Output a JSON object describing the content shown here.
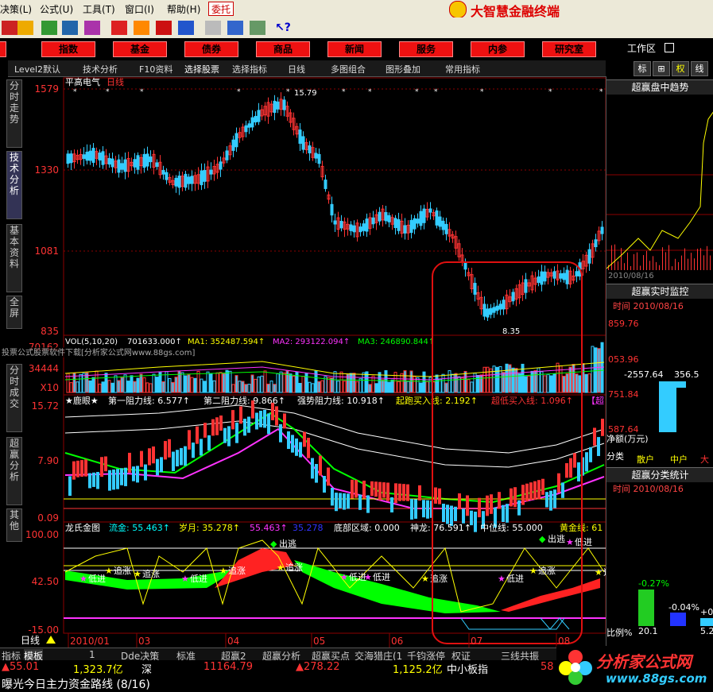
{
  "menu": {
    "items": [
      "决策(L)",
      "公式(U)",
      "工具(T)",
      "窗口(I)",
      "帮助(H)"
    ],
    "entrust": "委托",
    "app_title": "大智慧金融终端"
  },
  "nav": {
    "items": [
      "股",
      "指数",
      "基金",
      "债券",
      "商品",
      "新闻",
      "服务",
      "内参",
      "研究室"
    ],
    "workarea": "工作区"
  },
  "tabs": {
    "items": [
      "Level2默认",
      "技术分析",
      "F10资料",
      "选择股票",
      "选择指标",
      "日线",
      "多图组合",
      "图形叠加",
      "常用指标"
    ],
    "right": [
      "标",
      "⊞",
      "权",
      "线"
    ]
  },
  "left_tabs": [
    "分时走势",
    "技术分析",
    "基本资料",
    "全屏",
    "分时成交",
    "超赢分析",
    "其他"
  ],
  "main_chart": {
    "stock": "平高电气",
    "period": "日线",
    "y_labels": [
      "1579",
      "1330",
      "1081",
      "835"
    ],
    "high_mark": "15.79",
    "low_mark": "8.35"
  },
  "vol_panel": {
    "label": "VOL(5,10,20)",
    "value": "701633.000↑",
    "ma1": "MA1: 352487.594↑",
    "ma2": "MA2: 293122.094↑",
    "ma3": "MA3: 246890.844↑",
    "y_labels": [
      "70162",
      "34444",
      "X10"
    ],
    "watermark": "投票公式股票软件下载[分析家公式网www.88gs.com]"
  },
  "dy_panel": {
    "label": "★鹿眼★",
    "l1": "第一阻力线: 6.577↑",
    "l2": "第二阻力线: 9.866↑",
    "l3": "强势阻力线: 10.918↑",
    "l4": "起跑买入线: 2.192↑",
    "l5": "超低买入线: 1.096↑",
    "l6": "【超",
    "y_labels": [
      "15.72",
      "7.90",
      "0.09"
    ]
  },
  "lg_panel": {
    "label": "龙氏金图",
    "f1": "流金: 55.463↑",
    "f2": "岁月: 35.278↑",
    "f3": "55.463↑",
    "f4": "35.278",
    "f5": "底部区域: 0.000",
    "f6": "神龙: 76.591↑",
    "f7": "中位线: 55.000",
    "f8": "黄金线: 61",
    "y_labels": [
      "100.00",
      "42.50",
      "-15.00"
    ],
    "signals": [
      "低进",
      "追涨",
      "追涨",
      "低进",
      "追涨",
      "出逃",
      "追涨",
      "低进",
      "低进",
      "追涨",
      "低进",
      "追涨",
      "出逃",
      "低进",
      "追涨"
    ]
  },
  "x_axis": {
    "period": "日线",
    "labels": [
      "2010/01",
      "03",
      "04",
      "05",
      "06",
      "07",
      "08"
    ]
  },
  "right_panel": {
    "t1": "超赢盘中趋势",
    "d1": "2010/08/16",
    "t2": "超赢实时监控",
    "time2": "时间 2010/08/16",
    "y2": [
      "859.76",
      "053.96",
      "751.84",
      "587.64"
    ],
    "v2a": "-2557.64",
    "v2b": "356.5",
    "net": "净额(万元)",
    "cats": [
      "分类",
      "散户",
      "中户",
      "大户"
    ],
    "t3": "超赢分类统计",
    "time3": "时间 2010/08/16",
    "pcts": [
      "-0.27%",
      "-0.04%",
      "+0."
    ],
    "ratio": "比例%",
    "bvals": [
      "20.1",
      "",
      "5.2"
    ]
  },
  "bottom_tabs": [
    "指标",
    "模板",
    "1",
    "Dde决策",
    "标准",
    "超赢2",
    "超赢分析",
    "超赢买点",
    "交海猎庄(1",
    "千钧涨停",
    "权证",
    "三线共振",
    "58"
  ],
  "index_bar": {
    "a": "▲55.01",
    "b": "1,323.7亿",
    "c": "深",
    "d": "11164.79",
    "e": "▲278.22",
    "f": "1,125.2亿",
    "g": "中小板指"
  },
  "status": {
    "text": "曝光今日主力资金路线 (8/16)"
  },
  "logo": {
    "text": "分析家公式网",
    "url": "www.88gs.com"
  },
  "colors": {
    "up": "#ff3333",
    "down": "#33ccff",
    "grid": "#8b0000",
    "yellow": "#ffff00",
    "green": "#00ff00",
    "magenta": "#ff33ff"
  }
}
